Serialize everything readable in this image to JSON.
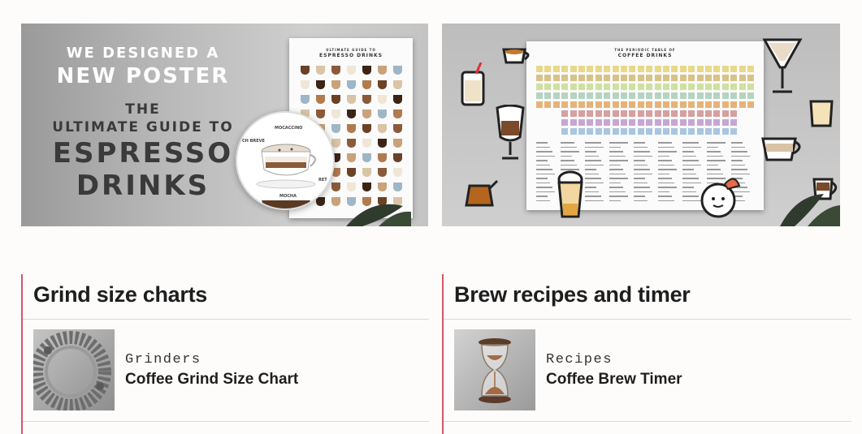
{
  "banners": {
    "left": {
      "line1": "WE DESIGNED A",
      "line2": "NEW POSTER",
      "line3": "THE",
      "line4": "ULTIMATE GUIDE TO",
      "line5": "ESPRESSO",
      "line6": "DRINKS",
      "poster_subtitle": "ULTIMATE GUIDE TO",
      "poster_title": "ESPRESSO DRINKS",
      "zoom_labels": [
        "MOCACCINO",
        "CH BREVE",
        "MOCHA",
        "RET"
      ]
    },
    "right": {
      "poster_subtitle": "THE PERIODIC TABLE OF",
      "poster_title": "COFFEE DRINKS"
    }
  },
  "sections": [
    {
      "title": "Grind size charts",
      "items": [
        {
          "category": "Grinders",
          "name": "Coffee Grind Size Chart",
          "icon": "grinder-burr-icon"
        }
      ]
    },
    {
      "title": "Brew recipes and timer",
      "items": [
        {
          "category": "Recipes",
          "name": "Coffee Brew Timer",
          "icon": "hourglass-icon"
        }
      ]
    }
  ],
  "colors": {
    "accent": "#d4566a",
    "divider": "#d9d9d9",
    "text": "#1e1e1e"
  }
}
